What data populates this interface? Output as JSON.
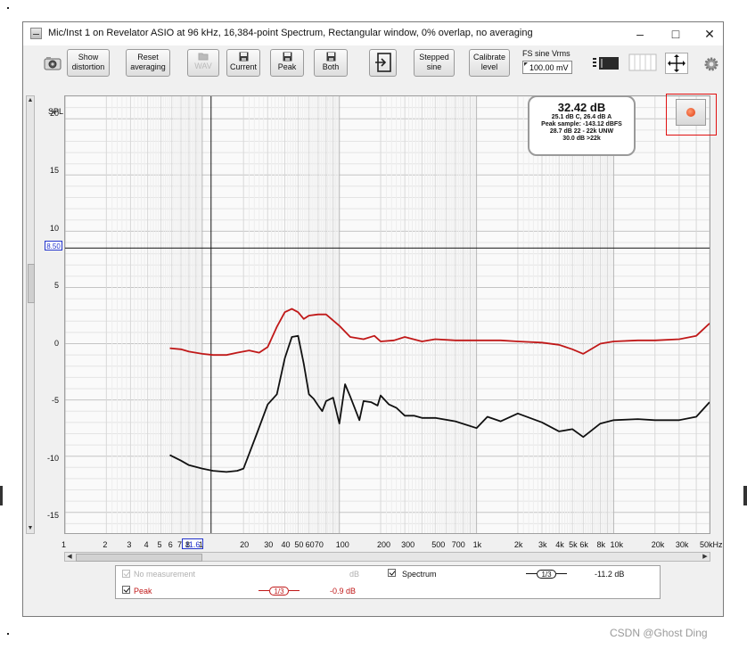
{
  "window": {
    "title": "Mic/Inst 1 on Revelator ASIO at 96 kHz, 16,384-point Spectrum, Rectangular window, 0% overlap, no averaging",
    "minimize": "–",
    "maximize": "□",
    "close": "✕"
  },
  "toolbar": {
    "show_distortion": "Show\ndistortion",
    "reset_averaging": "Reset\naveraging",
    "wav": "WAV",
    "current": "Current",
    "peak": "Peak",
    "both": "Both",
    "stepped_sine": "Stepped\nsine",
    "calibrate_level": "Calibrate\nlevel",
    "fs_label": "FS sine Vrms",
    "fs_value": "100.00 mV"
  },
  "plot": {
    "y_axis_title": "SPL",
    "y_ticks": [
      "20",
      "15",
      "10",
      "5",
      "0",
      "-5",
      "-10",
      "-15"
    ],
    "cursor_y": "8.50",
    "x_ticks": [
      "1",
      "2",
      "3",
      "4",
      "5",
      "6",
      "7",
      "8",
      "1",
      "20",
      "30",
      "40",
      "50",
      "60",
      "70",
      "100",
      "200",
      "300",
      "500",
      "700",
      "1k",
      "2k",
      "3k",
      "4k",
      "5k",
      "6k",
      "8k",
      "10k",
      "20k",
      "30k",
      "50kHz"
    ],
    "cursor_x": "11.6"
  },
  "info": {
    "main": "32.42 dB",
    "line1": "25.1 dB C, 26.4 dB A",
    "line2": "Peak sample: -143.12 dBFS",
    "line3": "28.7 dB 22 - 22k UNW",
    "line4": "30.0 dB >22k"
  },
  "legend": {
    "no_measurement": "No measurement",
    "no_measurement_unit": "dB",
    "spectrum": "Spectrum",
    "spectrum_smoothing": "1/3",
    "spectrum_value": "-11.2 dB",
    "peak": "Peak",
    "peak_smoothing": "1/3",
    "peak_value": "-0.9 dB"
  },
  "colors": {
    "peak_trace": "#c01818",
    "spectrum_trace": "#111111",
    "cursor": "#2233cc",
    "record_highlight": "#e01010"
  },
  "icons": {
    "camera": "camera-icon",
    "save": "save-icon",
    "input": "input-icon",
    "record": "record-icon",
    "settings": "gear-icon"
  },
  "watermark": "CSDN @Ghost Ding",
  "chart_data": {
    "type": "line",
    "xlabel": "",
    "ylabel": "SPL",
    "x_scale": "log",
    "xlim": [
      1,
      50000
    ],
    "ylim": [
      -17,
      22
    ],
    "grid": true,
    "cursor": {
      "x": 11.6,
      "y": 8.5
    },
    "series": [
      {
        "name": "Peak",
        "color": "#c01818",
        "x": [
          5.8,
          7,
          8,
          10,
          12,
          15,
          18,
          22,
          26,
          30,
          35,
          40,
          45,
          50,
          55,
          60,
          70,
          80,
          100,
          120,
          150,
          180,
          200,
          250,
          300,
          400,
          500,
          700,
          1000,
          1500,
          2000,
          3000,
          4000,
          5000,
          6000,
          8000,
          10000,
          15000,
          20000,
          30000,
          40000,
          50000
        ],
        "values": [
          -0.4,
          -0.5,
          -0.7,
          -0.9,
          -1.0,
          -1.0,
          -0.8,
          -0.6,
          -0.8,
          -0.3,
          1.5,
          2.8,
          3.1,
          2.8,
          2.2,
          2.5,
          2.6,
          2.6,
          1.6,
          0.6,
          0.4,
          0.7,
          0.2,
          0.3,
          0.6,
          0.2,
          0.4,
          0.3,
          0.3,
          0.3,
          0.2,
          0.1,
          -0.1,
          -0.5,
          -0.9,
          0.0,
          0.2,
          0.3,
          0.3,
          0.4,
          0.7,
          1.8
        ]
      },
      {
        "name": "Spectrum",
        "color": "#111111",
        "x": [
          5.8,
          7,
          8,
          10,
          12,
          15,
          18,
          20,
          25,
          30,
          35,
          40,
          45,
          50,
          55,
          60,
          65,
          70,
          75,
          80,
          90,
          100,
          110,
          120,
          130,
          140,
          150,
          170,
          190,
          200,
          230,
          260,
          300,
          350,
          400,
          500,
          700,
          1000,
          1200,
          1500,
          2000,
          3000,
          4000,
          5000,
          6000,
          8000,
          10000,
          15000,
          20000,
          30000,
          40000,
          50000
        ],
        "values": [
          -9.9,
          -10.4,
          -10.8,
          -11.1,
          -11.3,
          -11.4,
          -11.3,
          -11.1,
          -8.0,
          -5.4,
          -4.5,
          -1.3,
          0.6,
          0.7,
          -1.8,
          -4.5,
          -4.9,
          -5.5,
          -6.0,
          -5.1,
          -4.8,
          -7.1,
          -3.6,
          -4.7,
          -5.8,
          -6.8,
          -5.1,
          -5.2,
          -5.5,
          -4.6,
          -5.4,
          -5.7,
          -6.4,
          -6.4,
          -6.6,
          -6.6,
          -6.9,
          -7.5,
          -6.5,
          -6.9,
          -6.2,
          -7.0,
          -7.8,
          -7.6,
          -8.3,
          -7.1,
          -6.8,
          -6.7,
          -6.8,
          -6.8,
          -6.5,
          -5.2
        ]
      }
    ]
  }
}
